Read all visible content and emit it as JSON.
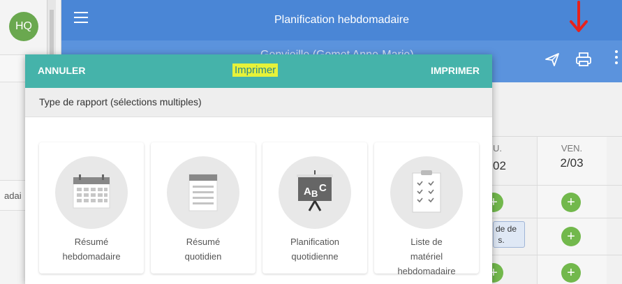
{
  "sidebar": {
    "avatar_initials": "HQ",
    "partial_text": "adai"
  },
  "header": {
    "title": "Planification hebdomadaire",
    "subtitle": "Genvieille (Gomet Anne-Marie)"
  },
  "background_grid": {
    "partial_day": "U.",
    "partial_date": "02",
    "day_name": "VEN.",
    "day_date": "2/03",
    "partial_chip": "de de\n s."
  },
  "dialog": {
    "cancel_label": "ANNULER",
    "title": "Imprimer",
    "print_label": "IMPRIMER",
    "section_label": "Type de rapport (sélections multiples)",
    "options": [
      {
        "label_line1": "Résumé",
        "label_line2": "hebdomadaire",
        "label_line3": "",
        "icon": "calendar-icon"
      },
      {
        "label_line1": "Résumé",
        "label_line2": "quotidien",
        "label_line3": "",
        "icon": "document-lines-icon"
      },
      {
        "label_line1": "Planification",
        "label_line2": "quotidienne",
        "label_line3": "",
        "icon": "abc-easel-icon"
      },
      {
        "label_line1": "Liste de",
        "label_line2": "matériel",
        "label_line3": "hebdomadaire",
        "icon": "checklist-clipboard-icon"
      }
    ]
  },
  "colors": {
    "header_blue": "#4a86d6",
    "dialog_teal": "#45b3aa",
    "highlight_yellow": "#e6f23a",
    "add_green": "#72b84c",
    "annotation_red": "#e8211b"
  }
}
